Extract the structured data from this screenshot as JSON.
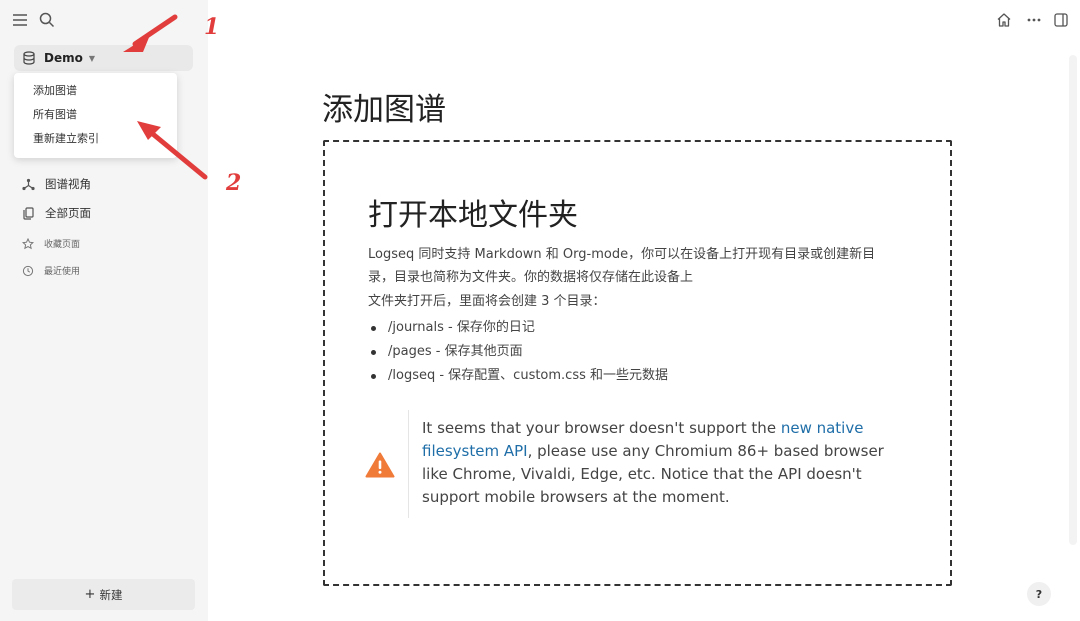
{
  "sidebar": {
    "repo": {
      "name": "Demo"
    },
    "dropdown": {
      "items": [
        "添加图谱",
        "所有图谱",
        "重新建立索引"
      ]
    },
    "nav": [
      {
        "label": "图谱视角",
        "icon": "graph-icon"
      },
      {
        "label": "全部页面",
        "icon": "pages-icon"
      }
    ],
    "nav_small": [
      {
        "label": "收藏页面",
        "icon": "star-icon"
      },
      {
        "label": "最近使用",
        "icon": "history-icon"
      }
    ],
    "new_button": {
      "plus": "+",
      "label": "新建"
    }
  },
  "annotations": {
    "one": "1",
    "two": "2",
    "color": "#e23d3d"
  },
  "main": {
    "title": "添加图谱",
    "card": {
      "heading": "打开本地文件夹",
      "description": "Logseq 同时支持 Markdown 和 Org-mode，你可以在设备上打开现有目录或创建新目录，目录也简称为文件夹。你的数据将仅存储在此设备上",
      "sub": "文件夹打开后，里面将会创建 3 个目录：",
      "dirs": [
        "/journals - 保存你的日记",
        "/pages - 保存其他页面",
        "/logseq - 保存配置、custom.css 和一些元数据"
      ],
      "warning": {
        "prefix": "It seems that your browser doesn't support the ",
        "link": "new native filesystem API",
        "suffix": ", please use any Chromium 86+ based browser like Chrome, Vivaldi, Edge, etc. Notice that the API doesn't support mobile browsers at the moment."
      }
    },
    "help": "?"
  },
  "colors": {
    "warning": "#f07a38",
    "link": "#1f6ea8"
  }
}
